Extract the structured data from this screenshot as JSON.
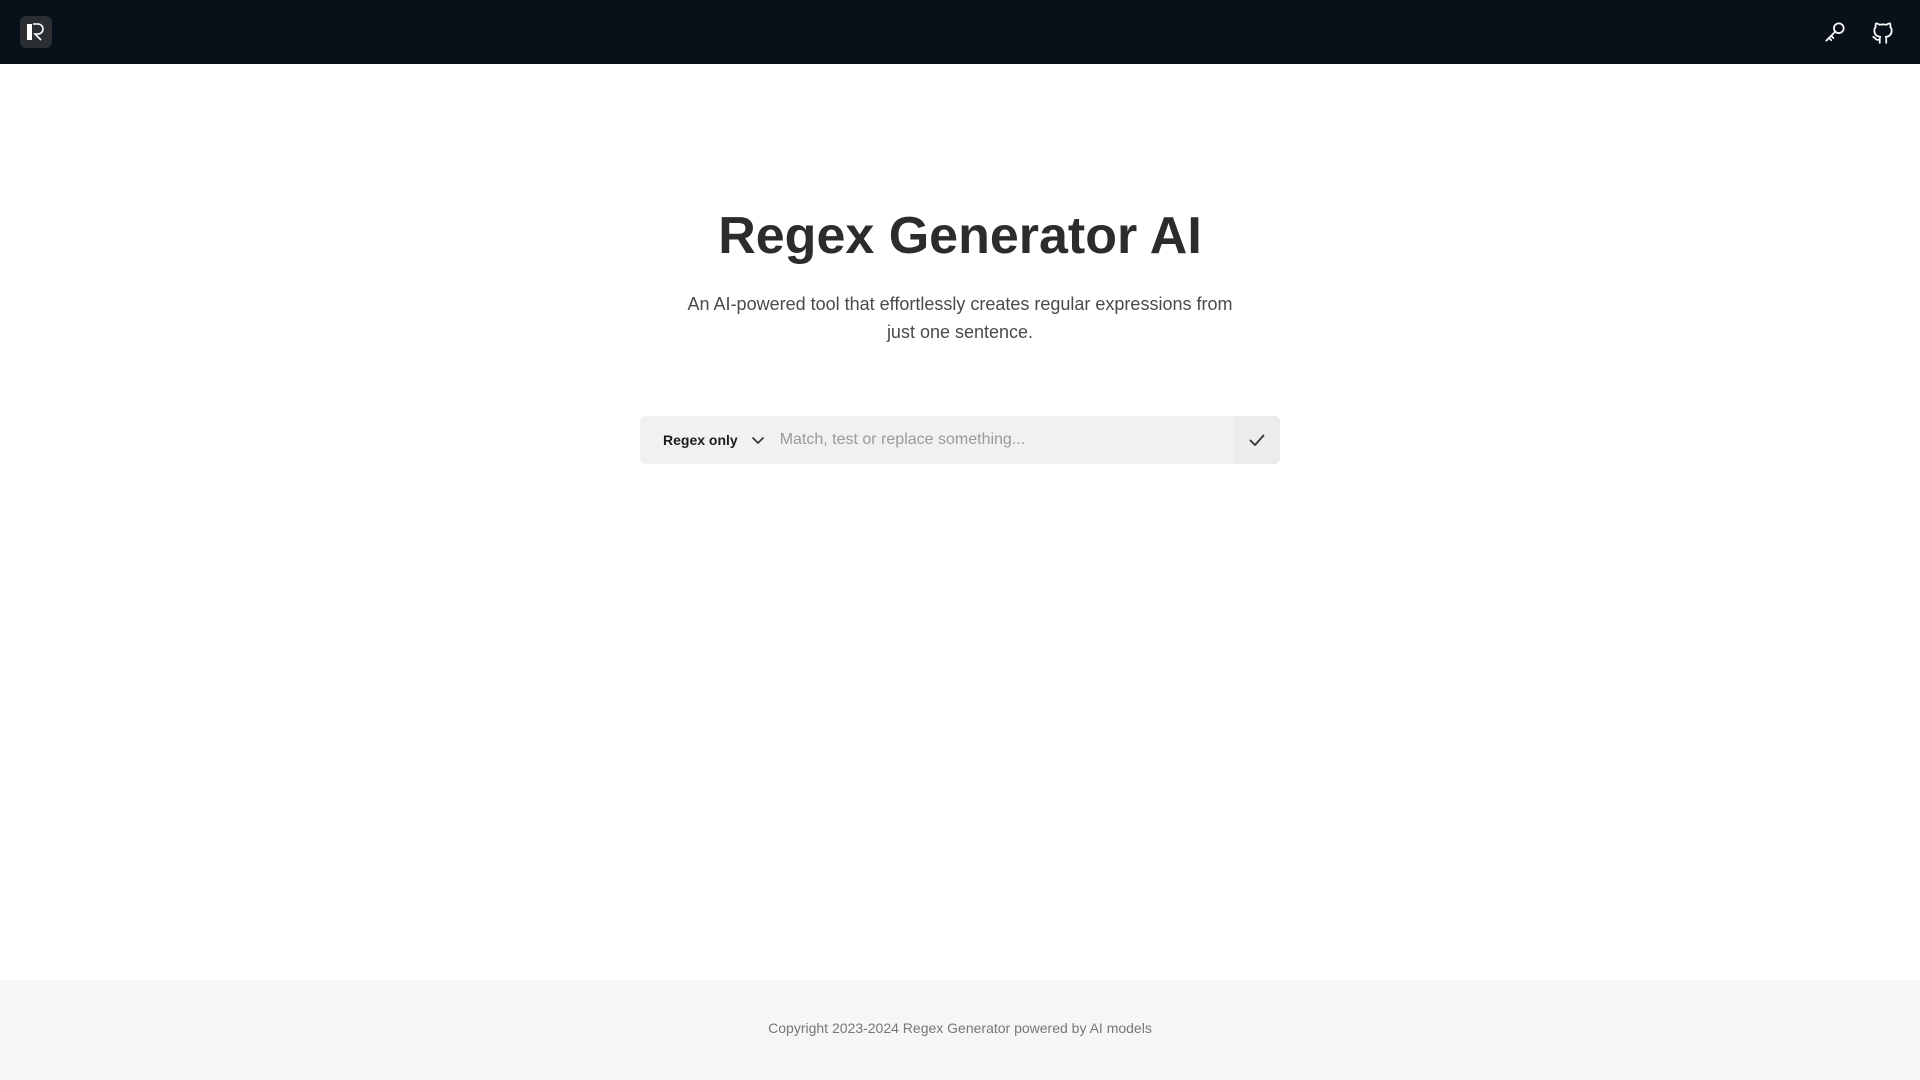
{
  "header": {
    "logo_letter": "R",
    "background_color": "#08111a",
    "actions": [
      {
        "icon": "key-icon"
      },
      {
        "icon": "github-icon"
      }
    ]
  },
  "hero": {
    "title": "Regex Generator AI",
    "subtitle": "An AI-powered tool that effortlessly creates regular expressions from just one sentence."
  },
  "search": {
    "mode_selected": "Regex only",
    "placeholder": "Match, test or replace something...",
    "value": "",
    "submit_icon": "check-icon"
  },
  "footer": {
    "text": "Copyright 2023-2024 Regex Generator powered by AI models"
  }
}
